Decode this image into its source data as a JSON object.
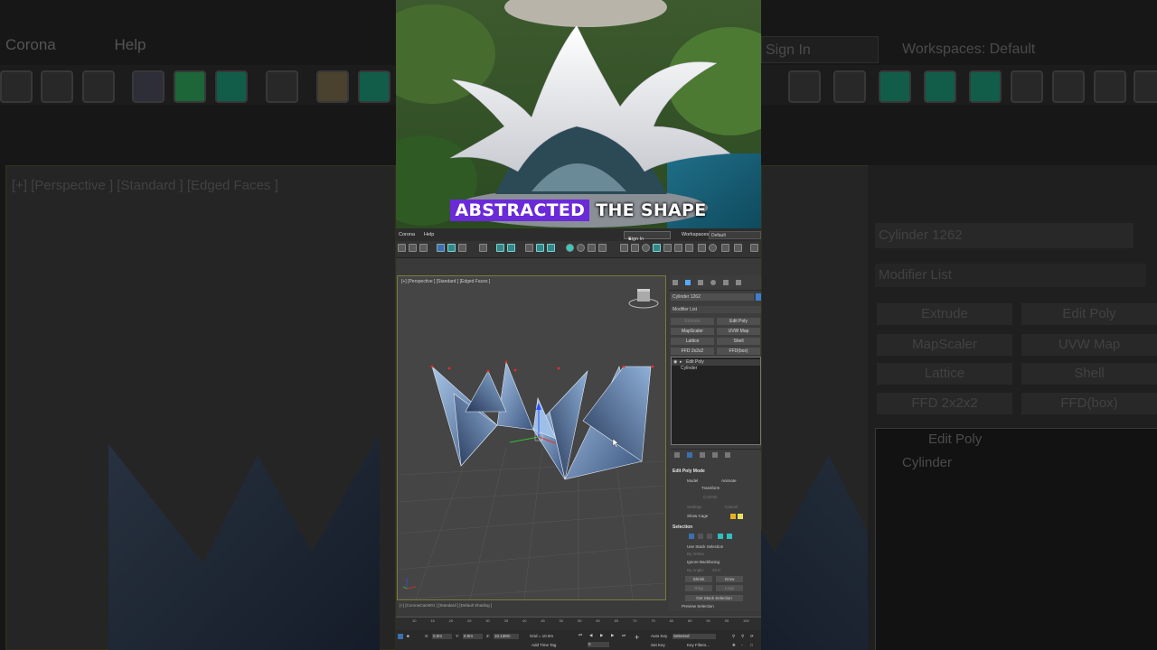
{
  "caption": {
    "highlight": "ABSTRACTED",
    "rest": "THE SHAPE"
  },
  "menu": {
    "corona": "Corona",
    "help": "Help"
  },
  "header": {
    "sign_in": "Sign In",
    "workspaces_label": "Workspaces:",
    "workspace_value": "Default"
  },
  "viewport": {
    "label": "[+] [Perspective ] [Standard ] [Edged Faces ]",
    "bottom_label": "[+] [CoronaCam001 ] [Standard ] [Default Shading ]"
  },
  "command_panel": {
    "object_name": "Cylinder 1262",
    "modifier_list": "Modifier List",
    "modifier_buttons": [
      "Extrude",
      "Edit Poly",
      "MapScaler",
      "UVW Map",
      "Lattice",
      "Shell",
      "FFD 2x2x2",
      "FFD(box)"
    ],
    "stack": [
      "Edit Poly",
      "Cylinder"
    ],
    "edit_poly_mode": {
      "title": "Edit Poly Mode",
      "model": "Model",
      "animate": "Animate",
      "transform": "Transform",
      "commit": "Commit",
      "settings": "Settings",
      "cancel": "Cancel",
      "show_cage": "Show Cage"
    },
    "selection": {
      "title": "Selection",
      "use_stack": "Use Stack Selection",
      "by_vertex": "By Vertex",
      "ignore_backfacing": "Ignore Backfacing",
      "by_angle": "By Angle:",
      "angle_value": "45.0",
      "shrink": "Shrink",
      "grow": "Grow",
      "ring": "Ring",
      "loop": "Loop",
      "get_stack": "Get Stack Selection",
      "preview": "Preview Selection"
    }
  },
  "timeline": {
    "ticks": [
      "10",
      "15",
      "20",
      "25",
      "30",
      "35",
      "40",
      "45",
      "50",
      "55",
      "60",
      "65",
      "70",
      "75",
      "80",
      "85",
      "90",
      "95",
      "100"
    ]
  },
  "status": {
    "x_label": "X:",
    "x_value": "0.0m",
    "y_label": "Y:",
    "y_value": "0.0m",
    "z_label": "Z:",
    "z_value": "10.138m",
    "grid": "Grid = 10.0m",
    "add_time_tag": "Add Time Tag",
    "auto_key": "Auto Key",
    "selected": "Selected",
    "set_key": "Set Key",
    "key_filters": "Key Filters...",
    "frame": "0"
  },
  "background": {
    "menu": [
      "Corona",
      "Help"
    ],
    "viewport_label": "[+] [Perspective ] [Standard ] [Edged Faces ]",
    "sign_in": "Sign In",
    "workspaces": "Workspaces:  Default",
    "object_name": "Cylinder 1262",
    "modifier_list": "Modifier List",
    "buttons": [
      "Extrude",
      "Edit Poly",
      "MapScaler",
      "UVW Map",
      "Lattice",
      "Shell",
      "FFD 2x2x2",
      "FFD(box)"
    ],
    "stack": [
      "Edit Poly",
      "Cylinder"
    ]
  },
  "colors": {
    "caption_highlight": "#6a2ad8",
    "viewport_border": "#7a7a3a",
    "accent_blue": "#3c7fd0"
  }
}
